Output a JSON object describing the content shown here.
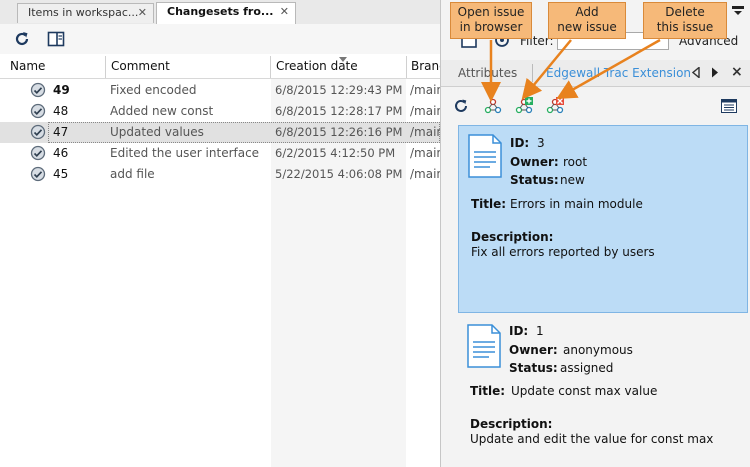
{
  "tabs": [
    {
      "label": "Items in workspac...",
      "active": false
    },
    {
      "label": "Changesets fro...",
      "active": true
    }
  ],
  "toolbar": {
    "refresh_icon": "refresh-icon",
    "panel_icon": "panel-toggle-icon"
  },
  "table": {
    "columns": [
      "Name",
      "Comment",
      "Creation date",
      "Branc"
    ],
    "rows": [
      {
        "num": "49",
        "comment": "Fixed encoded",
        "date": "6/8/2015 12:29:43 PM",
        "branch": "/main"
      },
      {
        "num": "48",
        "comment": "Added new const",
        "date": "6/8/2015 12:28:17 PM",
        "branch": "/main"
      },
      {
        "num": "47",
        "comment": "Updated values",
        "date": "6/8/2015 12:26:16 PM",
        "branch": "/main"
      },
      {
        "num": "46",
        "comment": "Edited the user interface",
        "date": "6/2/2015 4:12:50 PM",
        "branch": "/main"
      },
      {
        "num": "45",
        "comment": "add file",
        "date": "5/22/2015 4:06:08 PM",
        "branch": "/main"
      }
    ]
  },
  "panel": {
    "filter_label": "Filter:",
    "advanced_label": "Advanced",
    "subtabs": [
      "Attributes",
      "Edgewall Trac Extension"
    ],
    "close_glyph": "×"
  },
  "issues": [
    {
      "id_label": "ID:",
      "id": "3",
      "owner_label": "Owner:",
      "owner": "root",
      "status_label": "Status:",
      "status": "new",
      "title_label": "Title:",
      "title": "Errors in main module",
      "desc_label": "Description:",
      "desc": "Fix all errors reported by users"
    },
    {
      "id_label": "ID:",
      "id": "1",
      "owner_label": "Owner:",
      "owner": "anonymous",
      "status_label": "Status:",
      "status": "assigned",
      "title_label": "Title:",
      "title": "Update const max value",
      "desc_label": "Description:",
      "desc": "Update and edit the value for const max"
    }
  ],
  "callouts": {
    "open": [
      "Open issue",
      "in browser"
    ],
    "add": [
      "Add",
      "new issue"
    ],
    "delete": [
      "Delete",
      "this issue"
    ]
  },
  "colors": {
    "accent": "#3b8fd8",
    "callout": "#f6b979",
    "selected_card": "#bcdcf6"
  }
}
